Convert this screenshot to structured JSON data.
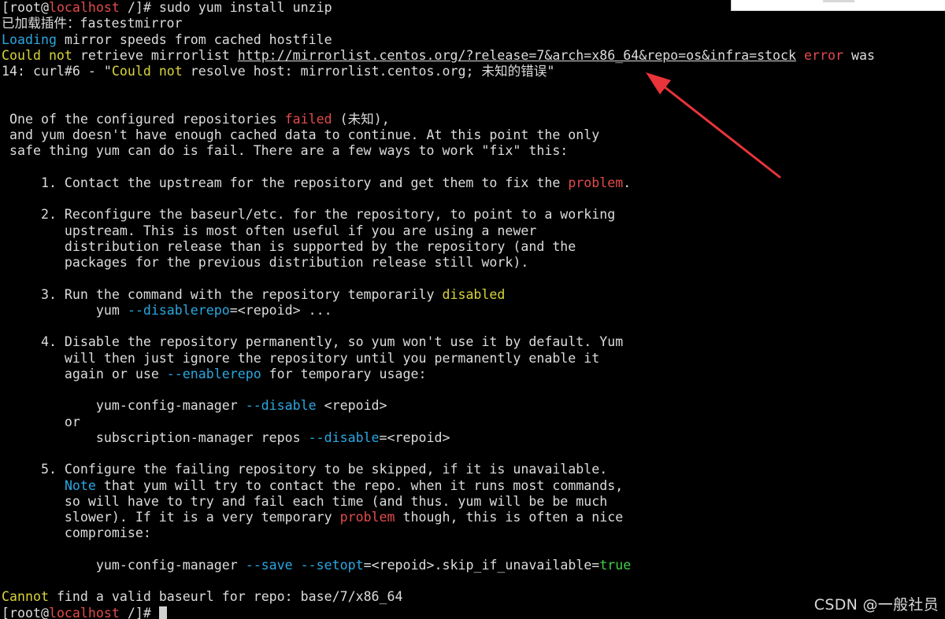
{
  "terminal": {
    "lines": [
      [
        {
          "t": "[root@"
        },
        {
          "t": "localhost",
          "cls": "r"
        },
        {
          "t": " /]# sudo yum install unzip"
        }
      ],
      [
        {
          "t": "已加载插件：fastestmirror"
        }
      ],
      [
        {
          "t": "Loading",
          "cls": "c"
        },
        {
          "t": " mirror speeds from cached hostfile"
        }
      ],
      [
        {
          "t": "Could not",
          "cls": "y"
        },
        {
          "t": " retrieve mirrorlist "
        },
        {
          "t": "http://mirrorlist.centos.org/?release=7&arch=x86_64&repo=os&infra=stock",
          "cls": "u"
        },
        {
          "t": " "
        },
        {
          "t": "error",
          "cls": "r"
        },
        {
          "t": " was"
        }
      ],
      [
        {
          "t": "14: curl#6 - \""
        },
        {
          "t": "Could not",
          "cls": "y"
        },
        {
          "t": " resolve host: mirrorlist.centos.org; 未知的错误\""
        }
      ],
      [],
      [],
      [
        {
          "t": " One of the configured repositories "
        },
        {
          "t": "failed",
          "cls": "r"
        },
        {
          "t": " (未知),"
        }
      ],
      [
        {
          "t": " and yum doesn't have enough cached data to continue. At this point the only"
        }
      ],
      [
        {
          "t": " safe thing yum can do is fail. There are a few ways to work \"fix\" this:"
        }
      ],
      [],
      [
        {
          "t": "     1. Contact the upstream for the repository and get them to fix the "
        },
        {
          "t": "problem",
          "cls": "r"
        },
        {
          "t": "."
        }
      ],
      [],
      [
        {
          "t": "     2. Reconfigure the baseurl/etc. for the repository, to point to a working"
        }
      ],
      [
        {
          "t": "        upstream. This is most often useful if you are using a newer"
        }
      ],
      [
        {
          "t": "        distribution release than is supported by the repository (and the"
        }
      ],
      [
        {
          "t": "        packages for the previous distribution release still work)."
        }
      ],
      [],
      [
        {
          "t": "     3. Run the command with the repository temporarily "
        },
        {
          "t": "disabled",
          "cls": "y"
        }
      ],
      [
        {
          "t": "            yum "
        },
        {
          "t": "--disablerepo",
          "cls": "c"
        },
        {
          "t": "=<repoid> ..."
        }
      ],
      [],
      [
        {
          "t": "     4. Disable the repository permanently, so yum won't use it by default. Yum"
        }
      ],
      [
        {
          "t": "        will then just ignore the repository until you permanently enable it"
        }
      ],
      [
        {
          "t": "        again or use "
        },
        {
          "t": "--enablerepo",
          "cls": "c"
        },
        {
          "t": " for temporary usage:"
        }
      ],
      [],
      [
        {
          "t": "            yum-config-manager "
        },
        {
          "t": "--disable",
          "cls": "c"
        },
        {
          "t": " <repoid>"
        }
      ],
      [
        {
          "t": "        or"
        }
      ],
      [
        {
          "t": "            subscription-manager repos "
        },
        {
          "t": "--disable",
          "cls": "c"
        },
        {
          "t": "=<repoid>"
        }
      ],
      [],
      [
        {
          "t": "     5. Configure the failing repository to be skipped, if it is unavailable."
        }
      ],
      [
        {
          "t": "        "
        },
        {
          "t": "Note",
          "cls": "c"
        },
        {
          "t": " that yum will try to contact the repo. when it runs most commands,"
        }
      ],
      [
        {
          "t": "        so will have to try and fail each time (and thus. yum will be be much"
        }
      ],
      [
        {
          "t": "        slower). If it is a very temporary "
        },
        {
          "t": "problem",
          "cls": "r"
        },
        {
          "t": " though, this is often a nice"
        }
      ],
      [
        {
          "t": "        compromise:"
        }
      ],
      [],
      [
        {
          "t": "            yum-config-manager "
        },
        {
          "t": "--save",
          "cls": "c"
        },
        {
          "t": " "
        },
        {
          "t": "--setopt",
          "cls": "c"
        },
        {
          "t": "=<repoid>.skip_if_unavailable="
        },
        {
          "t": "true",
          "cls": "g"
        }
      ],
      [],
      [
        {
          "t": "Cannot",
          "cls": "y"
        },
        {
          "t": " find a valid baseurl for repo: base/7/x86_64"
        }
      ],
      [
        {
          "t": "[root@"
        },
        {
          "t": "localhost",
          "cls": "r"
        },
        {
          "t": " /]# "
        },
        {
          "cursor": true
        }
      ]
    ]
  },
  "watermark": "CSDN @一般社员",
  "colors": {
    "background": "#000000",
    "text": "#dcdcdc",
    "red": "#e24b4b",
    "yellow": "#d8d33a",
    "cyan": "#2aa7e0",
    "green": "#3fcf4a",
    "arrow": "#e8343a"
  }
}
